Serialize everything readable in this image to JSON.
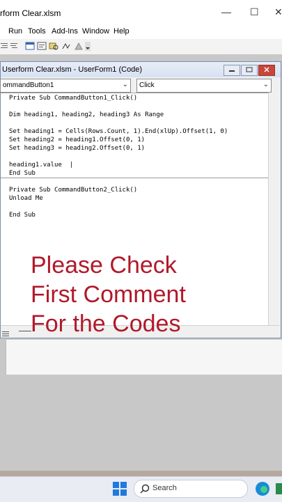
{
  "window": {
    "title": "rform Clear.xlsm",
    "minimize": "—",
    "maximize": "☐",
    "close": "✕"
  },
  "menu": {
    "items": [
      "Run",
      "Tools",
      "Add-Ins",
      "Window",
      "Help"
    ]
  },
  "code_window": {
    "title": "Userform Clear.xlsm - UserForm1 (Code)",
    "object_combo": "ommandButton1",
    "procedure_combo": "Click",
    "lines": [
      "Private Sub CommandButton1_Click()",
      "",
      "Dim heading1, heading2, heading3 As Range",
      "",
      "Set heading1 = Cells(Rows.Count, 1).End(xlUp).Offset(1, 0)",
      "Set heading2 = heading1.Offset(0, 1)",
      "Set heading3 = heading2.Offset(0, 1)",
      "",
      "heading1.value  |",
      "End Sub",
      "Private Sub CommandButton2_Click()",
      "Unload Me",
      "",
      "End Sub"
    ]
  },
  "overlay": {
    "line1": "Please Check",
    "line2": "First Comment",
    "line3": "For the Codes"
  },
  "taskbar": {
    "search_label": "Search"
  },
  "colors": {
    "overlay_text": "#b0192a",
    "keyword": "#00008b",
    "close_button": "#c8473a"
  }
}
